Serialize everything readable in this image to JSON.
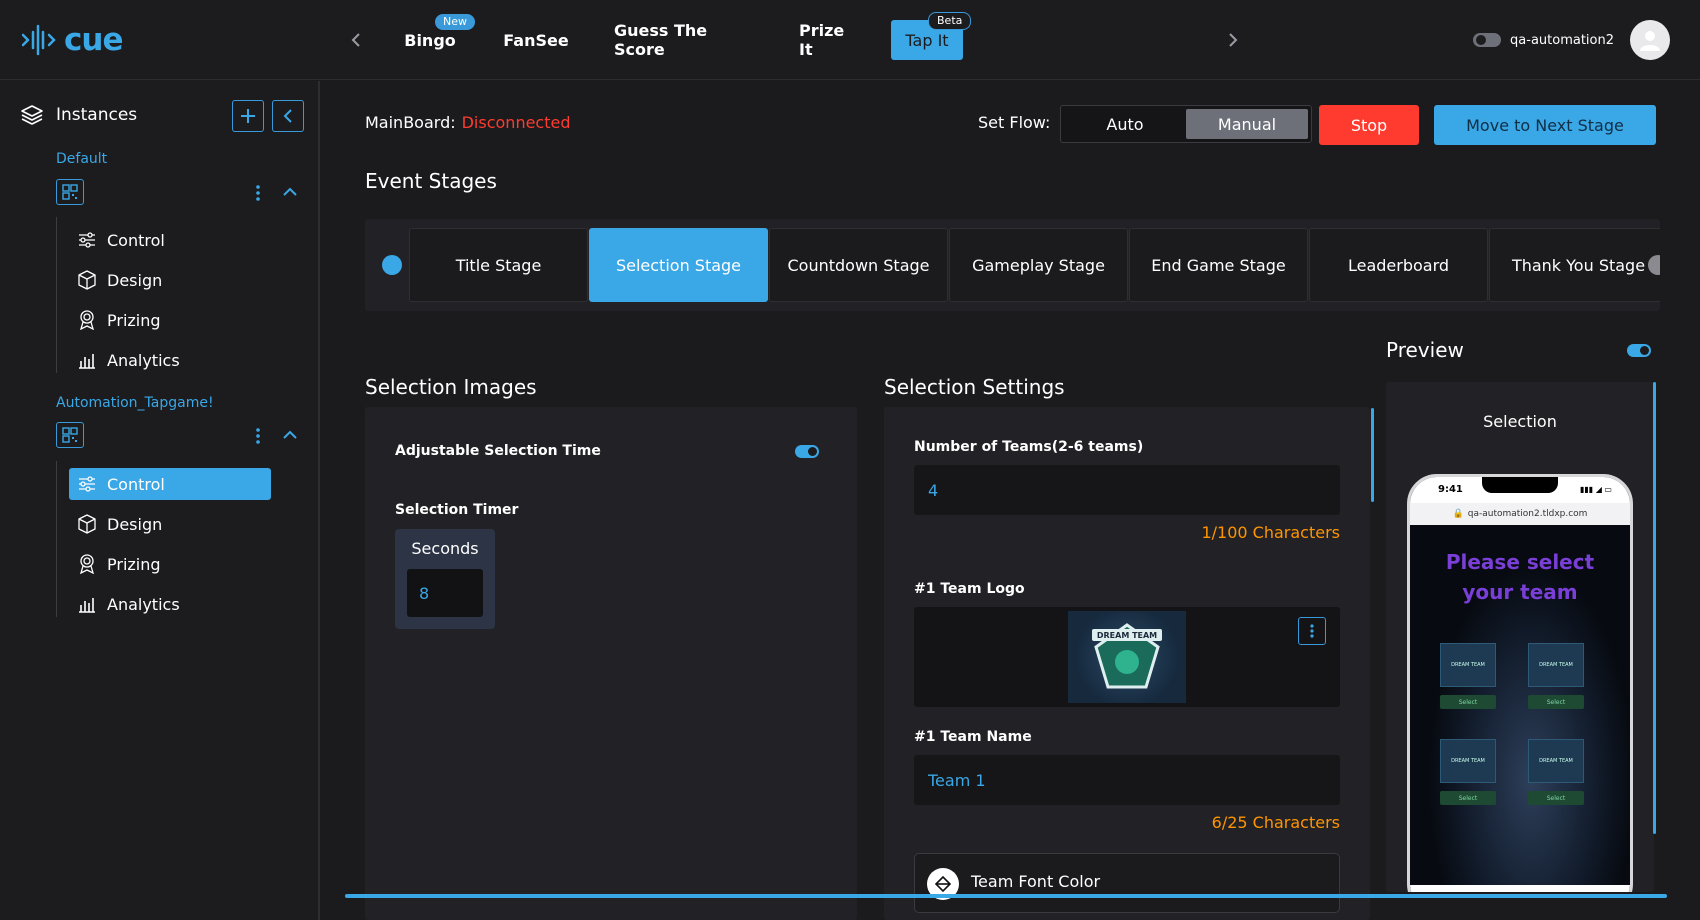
{
  "app": {
    "logo_text": "cue"
  },
  "topnav": {
    "tabs": [
      {
        "label": "Bingo",
        "badge": "New"
      },
      {
        "label": "FanSee"
      },
      {
        "label": "Guess The Score"
      },
      {
        "label": "Prize It"
      },
      {
        "label": "Tap It",
        "badge": "Beta"
      }
    ],
    "user": "qa-automation2"
  },
  "sidebar": {
    "title": "Instances",
    "instances": [
      {
        "name": "Default",
        "items": [
          {
            "label": "Control",
            "icon": "sliders-icon"
          },
          {
            "label": "Design",
            "icon": "cube-icon"
          },
          {
            "label": "Prizing",
            "icon": "award-icon"
          },
          {
            "label": "Analytics",
            "icon": "bar-chart-icon"
          }
        ]
      },
      {
        "name": "Automation_Tapgame!",
        "items": [
          {
            "label": "Control",
            "icon": "sliders-icon",
            "active": true
          },
          {
            "label": "Design",
            "icon": "cube-icon"
          },
          {
            "label": "Prizing",
            "icon": "award-icon"
          },
          {
            "label": "Analytics",
            "icon": "bar-chart-icon"
          }
        ]
      }
    ]
  },
  "header": {
    "mainboard_label": "MainBoard:",
    "mainboard_status": "Disconnected",
    "setflow_label": "Set Flow:",
    "flow_options": [
      "Auto",
      "Manual"
    ],
    "flow_selected": "Manual",
    "stop_label": "Stop",
    "next_label": "Move to Next Stage"
  },
  "stages": {
    "title": "Event Stages",
    "items": [
      "Title Stage",
      "Selection Stage",
      "Countdown Stage",
      "Gameplay Stage",
      "End Game Stage",
      "Leaderboard",
      "Thank You Stage"
    ],
    "active": "Selection Stage"
  },
  "selection_images": {
    "title": "Selection Images",
    "adjustable_label": "Adjustable Selection Time",
    "adjustable_on": true,
    "timer_label": "Selection Timer",
    "seconds_label": "Seconds",
    "seconds_value": "8"
  },
  "selection_settings": {
    "title": "Selection Settings",
    "teams_label": "Number of Teams(2-6 teams)",
    "teams_value": "4",
    "teams_counter": "1/100 Characters",
    "logo_label": "#1 Team Logo",
    "logo_text": "DREAM TEAM",
    "name_label": "#1 Team Name",
    "name_value": "Team 1",
    "name_counter": "6/25 Characters",
    "font_color_label": "Team Font Color"
  },
  "preview": {
    "title": "Preview",
    "enabled": true,
    "screen_title": "Selection",
    "phone_time": "9:41",
    "phone_url": "qa-automation2.tldxp.com",
    "phone_heading_1": "Please select",
    "phone_heading_2": "your team",
    "select_label": "Select",
    "card_label": "DREAM TEAM"
  },
  "colors": {
    "accent": "#3aa7e6",
    "danger": "#ff3b30",
    "warning": "#ff9500",
    "background": "#1b1b1d",
    "panel": "#222226"
  }
}
